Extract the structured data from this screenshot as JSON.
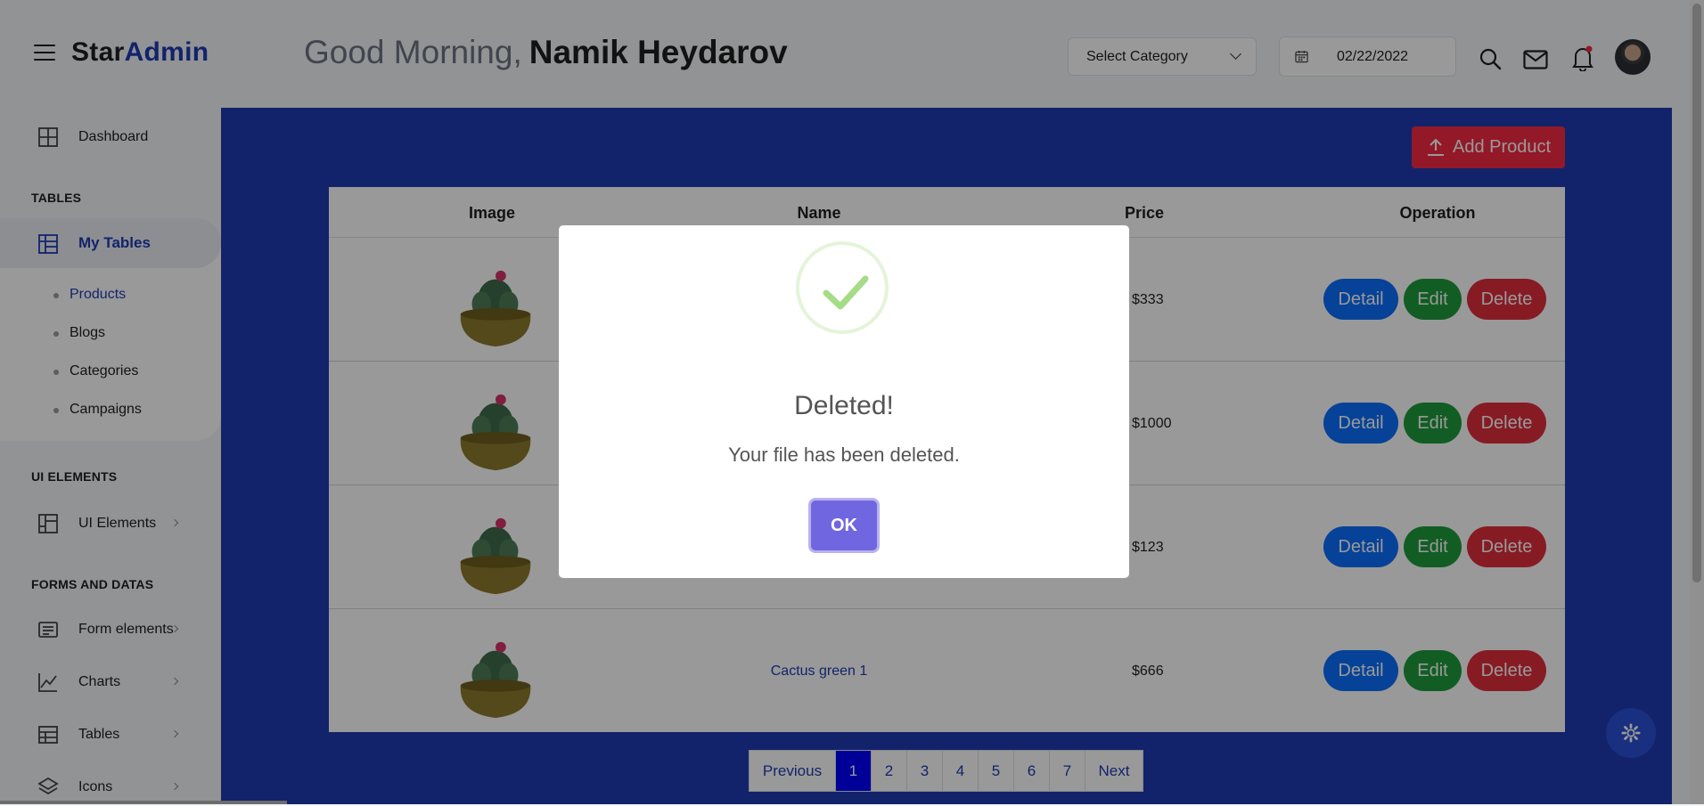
{
  "header": {
    "brand_part1": "Star",
    "brand_part2": "Admin",
    "greeting": "Good Morning,",
    "user_name": "Namik Heydarov",
    "category_select": "Select Category",
    "date": "02/22/2022"
  },
  "sidebar": {
    "dashboard": "Dashboard",
    "section_tables": "TABLES",
    "my_tables": "My Tables",
    "sub_items": [
      "Products",
      "Blogs",
      "Categories",
      "Campaigns"
    ],
    "section_ui": "UI ELEMENTS",
    "ui_elements": "UI Elements",
    "section_forms": "FORMS AND DATAS",
    "form_elements": "Form elements",
    "charts": "Charts",
    "tables": "Tables",
    "icons": "Icons"
  },
  "main": {
    "add_product": "Add Product",
    "columns": [
      "Image",
      "Name",
      "Price",
      "Operation"
    ],
    "rows": [
      {
        "name": "",
        "price": "$333"
      },
      {
        "name": "",
        "price": "$1000"
      },
      {
        "name": "",
        "price": "$123"
      },
      {
        "name": "Cactus green 1",
        "price": "$666"
      }
    ],
    "buttons": {
      "detail": "Detail",
      "edit": "Edit",
      "delete": "Delete"
    },
    "pagination": [
      "Previous",
      "1",
      "2",
      "3",
      "4",
      "5",
      "6",
      "7",
      "Next"
    ],
    "active_page": "1"
  },
  "modal": {
    "title": "Deleted!",
    "text": "Your file has been deleted.",
    "ok": "OK"
  },
  "colors": {
    "accent": "#1f3bb3",
    "danger": "#f52b44",
    "primary": "#0b6efd",
    "success": "#1e9b3c",
    "modal_button": "#7066e0"
  }
}
